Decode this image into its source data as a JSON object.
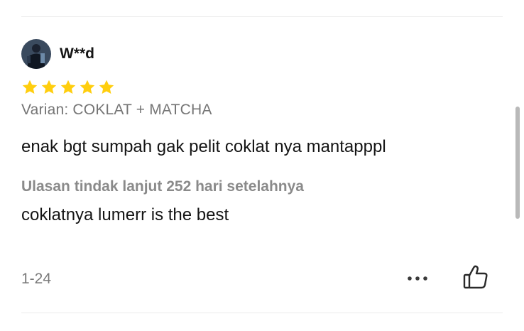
{
  "review": {
    "username": "W**d",
    "rating": 5,
    "max_rating": 5,
    "star_color": "#FFCE0E",
    "variant": "Varian: COKLAT + MATCHA",
    "text": "enak bgt sumpah gak pelit coklat nya mantapppl",
    "followup_label": "Ulasan tindak lanjut 252 hari setelahnya",
    "followup_text": "coklatnya lumerr is the best",
    "date": "1-24"
  },
  "icons": {
    "more": "more-dots-icon",
    "like": "thumbs-up-icon",
    "star": "star-icon"
  }
}
